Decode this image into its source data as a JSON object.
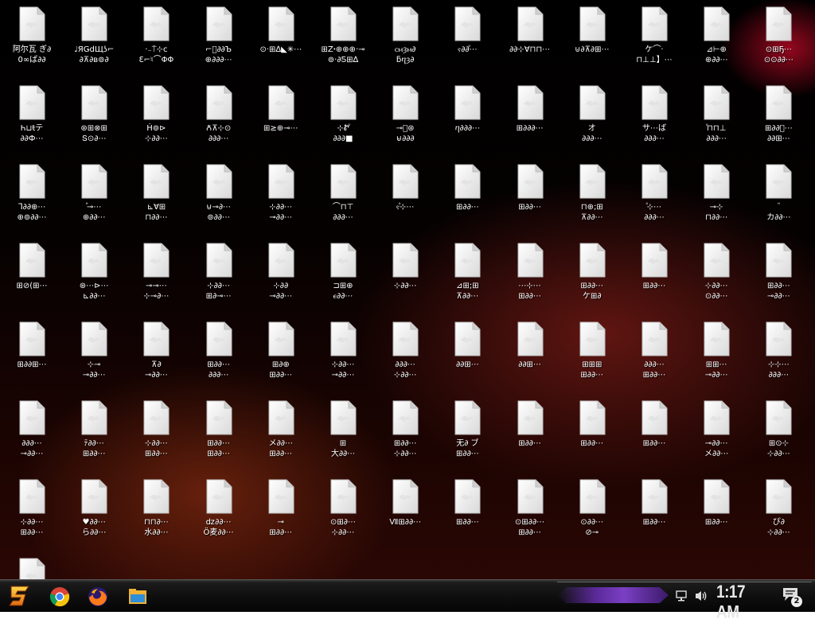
{
  "desktop": {
    "icons": [
      {
        "label": "阿尔瓦 ぎ∂\n0∞ば∂∂"
      },
      {
        "label": "♩ЯǤdЩʖ⌐\n∂⊼∂в⊚∂"
      },
      {
        "label": "·₋⍑⊹c\nƐ⌐♮⌒ΦΦ"
      },
      {
        "label": "⌐ⷧ∂∂Ъ\n⊕∂∂∂⋯"
      },
      {
        "label": "⊙·⊞∆◣✳⋯"
      },
      {
        "label": "⊞Zꞏ⊕⊕⊕·⊸\n⊚·∂Ƽ⊞∆"
      },
      {
        "label": "ⲥⲙȝⲙ∂\nƃⴄȝ∂"
      },
      {
        "label": "ⲋ∂∂ⷪ⋯"
      },
      {
        "label": "∂∂⊹Ɐ⊓⊓⋯"
      },
      {
        "label": "⊍∂⊼∂⊞⋯"
      },
      {
        "label": "ケ⌒·\n⊓⊥⊥】⋯"
      },
      {
        "label": "⊿⊢⊕\n⊕∂∂⋯"
      },
      {
        "label": "⊙⊞Ҕ⋯\n⊙⊙∂∂⋯"
      },
      {
        "label": "Һ⊔ŧテ\n∂∂Ф⋯"
      },
      {
        "label": "⊛⊞⊗⊞\nՏ⊙∂⋯"
      },
      {
        "label": "Ḣ⊚⊳\n⊹∂∂⋯"
      },
      {
        "label": "Ꙉ⊼⊹⊙\n∂∂∂⋯"
      },
      {
        "label": "⊞≥⊕⊸⋯"
      },
      {
        "label": "⊹Ꮡⷪ\n∂∂∂■"
      },
      {
        "label": "⊸ⷣ⊛\n⊌∂∂∂"
      },
      {
        "label": "ⴄ∂∂∂⋯"
      },
      {
        "label": "⊞∂∂∂⋯"
      },
      {
        "label": "オ\n∂∂∂⋯"
      },
      {
        "label": "サ⋯ば\n∂∂∂⋯"
      },
      {
        "label": "ⷪ⊓⊓⊥\n∂∂∂⋯"
      },
      {
        "label": "⊞∂∂ⷪ⋯\n∂∂⊞⋯"
      },
      {
        "label": "ᒣ∂∂⊕⋯\n⊕⊚∂∂⋯"
      },
      {
        "label": "ⷩ⊸⋯\n⊕∂∂⋯"
      },
      {
        "label": "⊾Ɐ⊞\n⊓∂∂⋯"
      },
      {
        "label": "⊍⊸∂⋯\n⊚∂∂⋯"
      },
      {
        "label": "⊹∂∂⋯\n⊸∂∂⋯"
      },
      {
        "label": "⌒⊓⊤\n∂∂∂⋯"
      },
      {
        "label": "ⲋⷪ⊹⋯"
      },
      {
        "label": "⊞∂∂⋯"
      },
      {
        "label": "⊞∂∂⋯"
      },
      {
        "label": "⊓⊕;⊞\n⊼∂∂⋯"
      },
      {
        "label": "ⷪⷩ⊹⋯\n∂∂∂⋯"
      },
      {
        "label": "⊸⊹\n⊓∂∂⋯"
      },
      {
        "label": "ⷩⷪ\nカ∂∂⋯"
      },
      {
        "label": "⊞⊘(⊞⋯"
      },
      {
        "label": "⊛⋯⊳⋯\n⊾∂∂⋯"
      },
      {
        "label": "⊸⊸⋯\n⊹⊸∂⋯"
      },
      {
        "label": "⊹∂∂⋯\n⊞∂⊸⋯"
      },
      {
        "label": "⊹∂∂\n⊸∂∂⋯"
      },
      {
        "label": "⊐⊞⊕\nⲉ∂∂⋯"
      },
      {
        "label": "⊹∂∂⋯"
      },
      {
        "label": "⊿⊞;⊞\n⊼∂∂⋯"
      },
      {
        "label": "⋯⊹⋯\n⊞∂∂⋯"
      },
      {
        "label": "⊞∂∂⋯\nケ⊞∂"
      },
      {
        "label": "⊞∂∂⋯"
      },
      {
        "label": "⊹∂∂⋯\n⊙∂∂⋯"
      },
      {
        "label": "⊞∂∂⋯\n⊸∂∂⋯"
      },
      {
        "label": "⊞∂∂⊞⋯"
      },
      {
        "label": "⊹⊸\n⊸∂∂⋯"
      },
      {
        "label": "⊼∂\n⊸∂∂⋯"
      },
      {
        "label": "⊞∂∂⋯\n∂∂∂⋯"
      },
      {
        "label": "⊞∂⊕\n⊞∂∂⋯"
      },
      {
        "label": "⊹∂∂⋯\n⊸∂∂⋯"
      },
      {
        "label": "∂∂∂⋯\n⊹∂∂⋯"
      },
      {
        "label": "∂∂⊞⋯"
      },
      {
        "label": "∂∂⊞⋯"
      },
      {
        "label": "⊞⊞⊞\n⊞∂∂⋯"
      },
      {
        "label": "∂∂∂⋯\n⊞∂∂⋯"
      },
      {
        "label": "⊞⊞⋯\n⊸∂∂⋯"
      },
      {
        "label": "⊹⊹⋯\n∂∂∂⋯"
      },
      {
        "label": "∂∂∂⋯\n⊸∂∂⋯"
      },
      {
        "label": "ﾃ∂∂⋯\n⊞∂∂⋯"
      },
      {
        "label": "⊹∂∂⋯\n⊞∂∂⋯"
      },
      {
        "label": "⊞∂∂⋯\n⊞∂∂⋯"
      },
      {
        "label": "メ∂∂⋯\n⊞∂∂⋯"
      },
      {
        "label": "⊞\n大∂∂⋯"
      },
      {
        "label": "⊞∂∂⋯\n⊹∂∂⋯"
      },
      {
        "label": "无∂ ブ\n⊞∂∂⋯"
      },
      {
        "label": "⊞∂∂⋯"
      },
      {
        "label": "⊞∂∂⋯"
      },
      {
        "label": "⊞∂∂⋯"
      },
      {
        "label": "⊸∂∂⋯\nメ∂∂⋯"
      },
      {
        "label": "⊞⊙⊹\n⊹∂∂⋯"
      },
      {
        "label": "⊹∂∂⋯\n⊞∂∂⋯"
      },
      {
        "label": "♥∂∂⋯\nら∂∂⋯"
      },
      {
        "label": "⊓⊓∂⋯\n水∂∂⋯"
      },
      {
        "label": "ǳ∂∂⋯\nÖ麦∂∂⋯"
      },
      {
        "label": "⊸\n⊞∂∂⋯"
      },
      {
        "label": "⊙⊞∂⋯\n⊹∂∂⋯"
      },
      {
        "label": "Ⅶ⊞∂∂⋯"
      },
      {
        "label": "⊞∂∂⋯"
      },
      {
        "label": "⊙⊞∂∂⋯\n⊞∂∂⋯"
      },
      {
        "label": "⊙∂∂⋯\n⊘⊸"
      },
      {
        "label": "⊞∂∂⋯"
      },
      {
        "label": "⊞∂∂⋯"
      },
      {
        "label": "ぴ∂\n⊹∂∂⋯"
      },
      {
        "label": "⊞∂∂⋯\n⊞∂∂⋯"
      }
    ]
  },
  "taskbar": {
    "clock": "1:17 AM",
    "notification_count": "2"
  },
  "colors": {
    "accent_purple": "#7b3fc4",
    "desktop_red": "#c80a28",
    "label_text": "#ffffff"
  }
}
